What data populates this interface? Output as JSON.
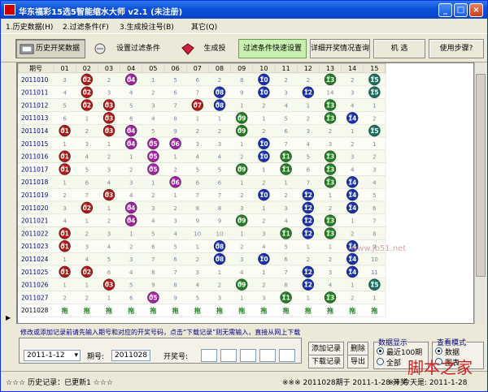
{
  "window": {
    "title": "华东福彩15选5智能缩水大师 v2.1  (未注册)",
    "btn_min": "_",
    "btn_max": "□",
    "btn_close": "×"
  },
  "menu": [
    "1.历史数据(H)",
    "2.过滤条件(F)",
    "3.生成投注号(B)",
    "其它(Q)"
  ],
  "toolbar": {
    "history": "历史开奖数据",
    "set_filter": "设置过滤条件",
    "generate": "生成投",
    "quick_filter": "过滤条件快速设置",
    "detail": "详细开奖情况查询",
    "random": "机 选",
    "help": "使用步骤?"
  },
  "grid": {
    "header_first": "期号",
    "columns": [
      "01",
      "02",
      "03",
      "04",
      "05",
      "06",
      "07",
      "08",
      "09",
      "10",
      "11",
      "12",
      "13",
      "14",
      "15"
    ],
    "rows": [
      {
        "issue": "2011010",
        "cells": [
          "3",
          "02",
          "2",
          "04",
          "1",
          "5",
          "6",
          "2",
          "8",
          "10",
          "2",
          "2",
          "13",
          "2",
          "15"
        ],
        "balls": [
          2,
          4,
          10,
          13,
          15
        ]
      },
      {
        "issue": "2011011",
        "cells": [
          "4",
          "02",
          "3",
          "4",
          "2",
          "6",
          "7",
          "08",
          "9",
          "10",
          "3",
          "12",
          "14",
          "3",
          "15"
        ],
        "balls": [
          2,
          8,
          10,
          12,
          15
        ]
      },
      {
        "issue": "2011012",
        "cells": [
          "5",
          "02",
          "03",
          "5",
          "3",
          "7",
          "07",
          "08",
          "1",
          "2",
          "4",
          "1",
          "13",
          "4",
          "1"
        ],
        "balls": [
          2,
          3,
          7,
          8,
          13
        ]
      },
      {
        "issue": "2011013",
        "cells": [
          "6",
          "1",
          "03",
          "6",
          "4",
          "8",
          "1",
          "1",
          "09",
          "1",
          "5",
          "2",
          "13",
          "14",
          "2"
        ],
        "balls": [
          3,
          9,
          13,
          14
        ]
      },
      {
        "issue": "2011014",
        "cells": [
          "01",
          "2",
          "03",
          "04",
          "5",
          "9",
          "2",
          "2",
          "09",
          "2",
          "6",
          "3",
          "2",
          "1",
          "15"
        ],
        "balls": [
          1,
          3,
          4,
          9,
          15
        ]
      },
      {
        "issue": "2011015",
        "cells": [
          "1",
          "3",
          "1",
          "04",
          "05",
          "06",
          "3",
          "3",
          "1",
          "10",
          "7",
          "4",
          "3",
          "2",
          "1"
        ],
        "balls": [
          4,
          5,
          6,
          10
        ]
      },
      {
        "issue": "2011016",
        "cells": [
          "01",
          "4",
          "2",
          "1",
          "05",
          "1",
          "4",
          "4",
          "2",
          "10",
          "11",
          "5",
          "13",
          "3",
          "2"
        ],
        "balls": [
          1,
          5,
          10,
          11,
          13
        ]
      },
      {
        "issue": "2011017",
        "cells": [
          "01",
          "5",
          "3",
          "2",
          "05",
          "2",
          "5",
          "5",
          "09",
          "1",
          "11",
          "6",
          "13",
          "4",
          "3"
        ],
        "balls": [
          1,
          5,
          9,
          11,
          13
        ]
      },
      {
        "issue": "2011018",
        "cells": [
          "1",
          "6",
          "4",
          "3",
          "1",
          "06",
          "6",
          "6",
          "1",
          "2",
          "1",
          "7",
          "13",
          "14",
          "4"
        ],
        "balls": [
          6,
          13,
          14
        ]
      },
      {
        "issue": "2011019",
        "cells": [
          "2",
          "7",
          "03",
          "4",
          "2",
          "1",
          "7",
          "7",
          "2",
          "10",
          "2",
          "12",
          "1",
          "14",
          "5"
        ],
        "balls": [
          3,
          10,
          12,
          14
        ]
      },
      {
        "issue": "2011020",
        "cells": [
          "3",
          "02",
          "1",
          "04",
          "3",
          "2",
          "8",
          "8",
          "3",
          "1",
          "3",
          "12",
          "2",
          "14",
          "6"
        ],
        "balls": [
          2,
          4,
          12,
          14
        ]
      },
      {
        "issue": "2011021",
        "cells": [
          "4",
          "1",
          "2",
          "04",
          "4",
          "3",
          "9",
          "9",
          "09",
          "2",
          "4",
          "12",
          "13",
          "1",
          "7"
        ],
        "balls": [
          4,
          9,
          12,
          13
        ]
      },
      {
        "issue": "2011022",
        "cells": [
          "01",
          "2",
          "3",
          "1",
          "5",
          "4",
          "10",
          "10",
          "1",
          "3",
          "11",
          "12",
          "13",
          "2",
          "8"
        ],
        "balls": [
          1,
          11,
          12,
          13
        ]
      },
      {
        "issue": "2011023",
        "cells": [
          "01",
          "3",
          "4",
          "2",
          "6",
          "5",
          "1",
          "08",
          "2",
          "4",
          "5",
          "1",
          "1",
          "14",
          "9"
        ],
        "balls": [
          1,
          8,
          14
        ]
      },
      {
        "issue": "2011024",
        "cells": [
          "1",
          "4",
          "5",
          "3",
          "7",
          "6",
          "2",
          "08",
          "3",
          "10",
          "6",
          "2",
          "2",
          "14",
          "10"
        ],
        "balls": [
          8,
          10,
          14
        ]
      },
      {
        "issue": "2011025",
        "cells": [
          "01",
          "02",
          "6",
          "4",
          "8",
          "7",
          "3",
          "1",
          "4",
          "1",
          "7",
          "12",
          "3",
          "14",
          "11"
        ],
        "balls": [
          1,
          2,
          12,
          14
        ]
      },
      {
        "issue": "2011026",
        "cells": [
          "1",
          "1",
          "03",
          "5",
          "9",
          "8",
          "4",
          "2",
          "09",
          "2",
          "8",
          "12",
          "4",
          "1",
          "15"
        ],
        "balls": [
          3,
          9,
          12,
          15
        ]
      },
      {
        "issue": "2011027",
        "cells": [
          "2",
          "2",
          "1",
          "6",
          "05",
          "9",
          "5",
          "3",
          "1",
          "3",
          "11",
          "1",
          "13",
          "2",
          "1"
        ],
        "balls": [
          5,
          11,
          13
        ]
      },
      {
        "issue": "2011028",
        "cells": [
          "拖",
          "拖",
          "拖",
          "拖",
          "拖",
          "拖",
          "拖",
          "拖",
          "拖",
          "拖",
          "拖",
          "拖",
          "拖",
          "拖",
          "拖"
        ],
        "balls": []
      }
    ]
  },
  "bottom": {
    "hint": "修改或添加记录前请先输入期号和对应的开奖号码，点击“下载记录”则无需输入，直接从网上下载",
    "date": "2011-1-12",
    "issue_label": "期号:",
    "issue_value": "2011028",
    "prize_label": "开奖号:",
    "add_record": "添加记录",
    "delete": "删除",
    "download": "下载记录",
    "export": "导出",
    "data_display": "数据显示",
    "recent100": "最近100期",
    "all": "全部",
    "view_mode": "查看模式",
    "data": "数据",
    "chart": "图表"
  },
  "status": {
    "left": "☆☆☆ 历史记录：已更新1 ☆☆☆",
    "mid": "※※※ 2011028期于 2011-1-28 开奖",
    "right": "※※ 今天是: 2011-1-28"
  },
  "watermark": {
    "big": "脚本之家",
    "url": "www.jb51.net"
  },
  "colors": {
    "red": "#b01818",
    "purple": "#a020a0",
    "blue": "#1830b0",
    "green": "#208020",
    "teal": "#187060"
  }
}
